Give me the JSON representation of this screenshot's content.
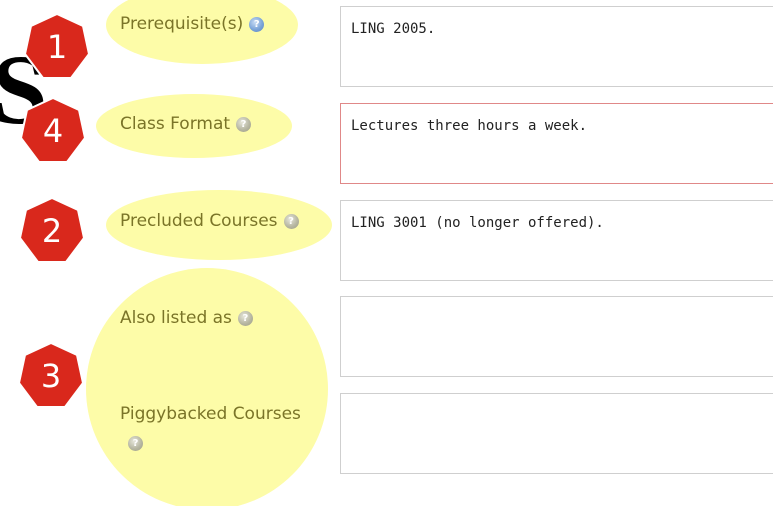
{
  "background_glyph": "S",
  "highlight_color": "#fdfca8",
  "badge_color": "#d9281c",
  "fields": [
    {
      "label": "Prerequisite(s)",
      "icon": "help-icon",
      "value": "LING 2005."
    },
    {
      "label": "Class Format",
      "icon": "help-icon",
      "value": "Lectures three hours a week."
    },
    {
      "label": "Precluded Courses",
      "icon": "help-icon",
      "value": "LING 3001 (no longer offered)."
    },
    {
      "label": "Also listed as",
      "icon": "help-icon",
      "value": ""
    },
    {
      "label": "Piggybacked Courses",
      "icon": "help-icon",
      "value": ""
    }
  ],
  "badges": [
    "1",
    "4",
    "2",
    "3"
  ]
}
